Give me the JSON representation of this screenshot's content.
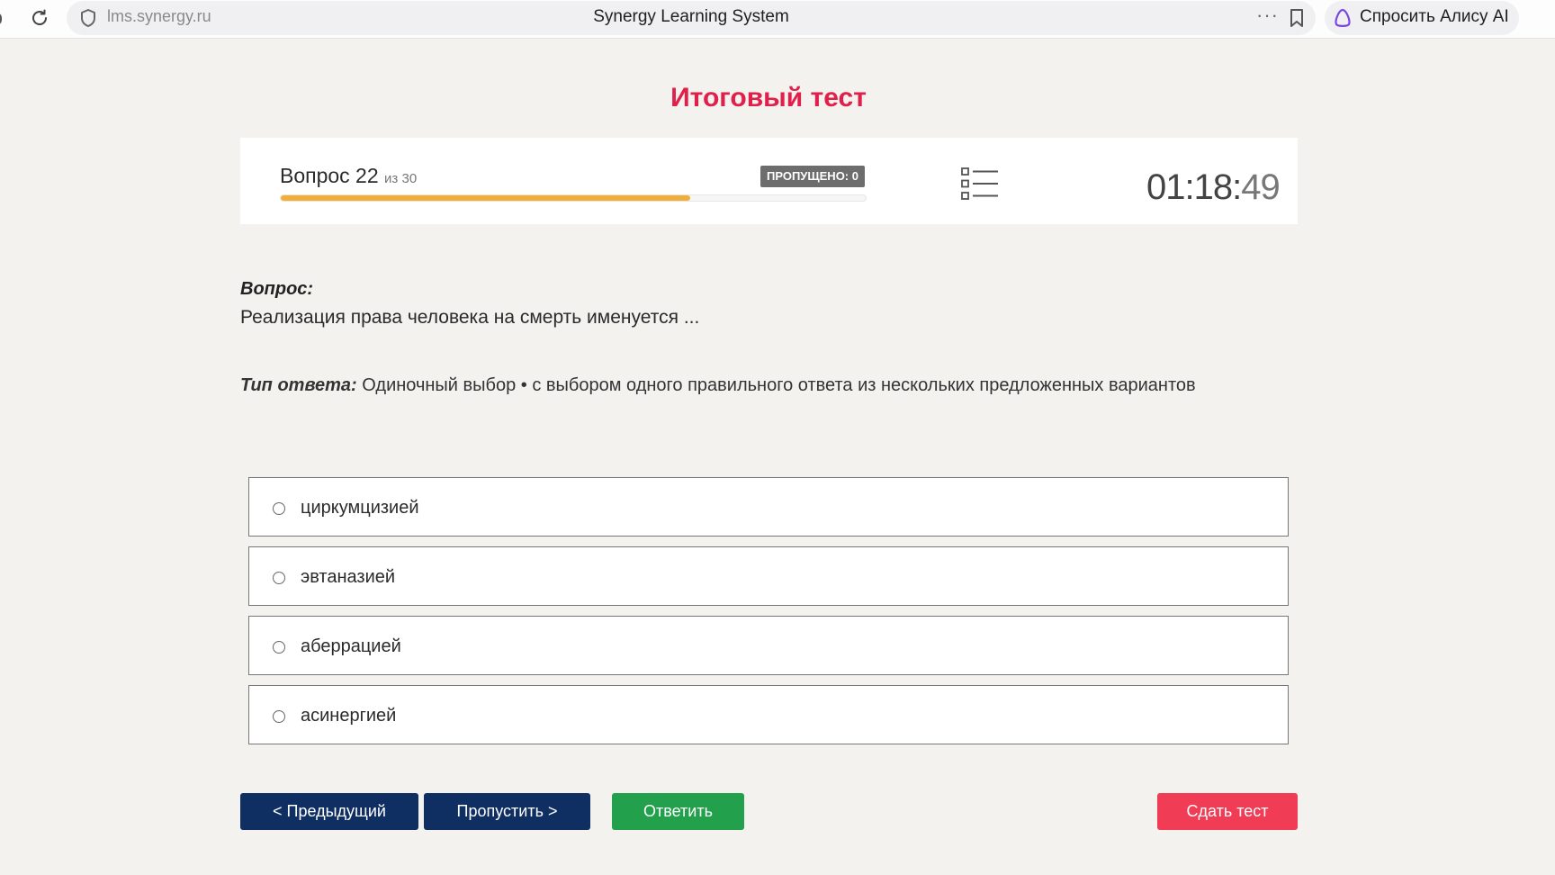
{
  "browser": {
    "url": "lms.synergy.ru",
    "tab_title": "Synergy Learning System",
    "more_label": "···",
    "alice_label": "Спросить Алису AI"
  },
  "test": {
    "title": "Итоговый тест",
    "question_label": "Вопрос 22",
    "question_of": "из 30",
    "skipped": "ПРОПУЩЕНО: 0",
    "progress_fraction": 0.7,
    "timer_main": "01:18:",
    "timer_seconds": "49"
  },
  "question": {
    "heading": "Вопрос:",
    "text": "Реализация права человека на смерть именуется ...",
    "answer_type_label": "Тип ответа:",
    "answer_type_value": " Одиночный выбор • с выбором одного правильного ответа из нескольких предложенных вариантов"
  },
  "options": [
    {
      "label": "циркумцизией"
    },
    {
      "label": "эвтаназией"
    },
    {
      "label": "аберрацией"
    },
    {
      "label": "асинергией"
    }
  ],
  "buttons": {
    "prev": "< Предыдущий",
    "skip": "Пропустить >",
    "answer": "Ответить",
    "submit": "Сдать тест"
  },
  "colors": {
    "title_red": "#e0204a",
    "progress": "#f2ae3a",
    "navy": "#0f2f63",
    "green": "#22a04b",
    "submit_red": "#f03c55"
  }
}
